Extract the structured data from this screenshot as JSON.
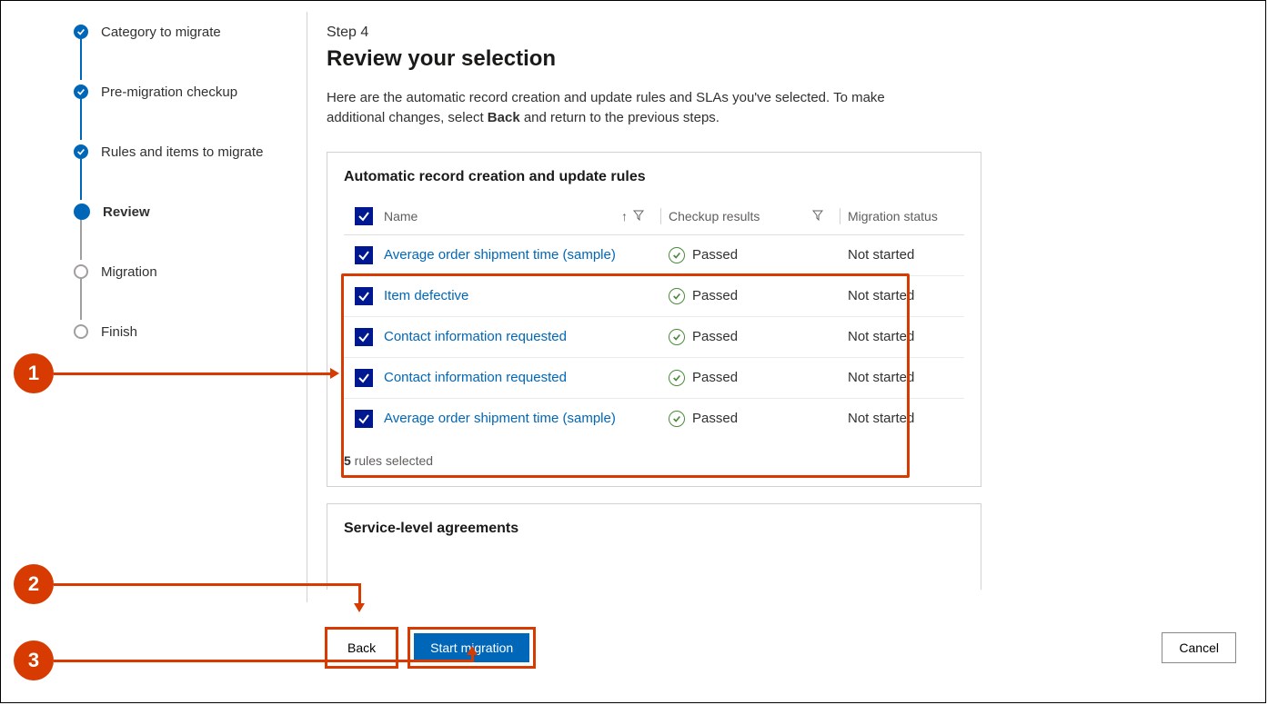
{
  "steps": [
    {
      "label": "Category to migrate",
      "state": "done"
    },
    {
      "label": "Pre-migration checkup",
      "state": "done"
    },
    {
      "label": "Rules and items to migrate",
      "state": "done"
    },
    {
      "label": "Review",
      "state": "current"
    },
    {
      "label": "Migration",
      "state": "future"
    },
    {
      "label": "Finish",
      "state": "future"
    }
  ],
  "header": {
    "step_no": "Step 4",
    "title": "Review your selection",
    "intro_pre": "Here are the automatic record creation and update rules and SLAs you've selected. To make additional changes, select ",
    "intro_bold": "Back",
    "intro_post": " and return to the previous steps."
  },
  "panel1": {
    "title": "Automatic record creation and update rules",
    "cols": {
      "name": "Name",
      "checkup": "Checkup results",
      "migration": "Migration status"
    },
    "rows": [
      {
        "name": "Average order shipment time (sample)",
        "checkup": "Passed",
        "migration": "Not started"
      },
      {
        "name": "Item defective",
        "checkup": "Passed",
        "migration": "Not started"
      },
      {
        "name": "Contact information requested",
        "checkup": "Passed",
        "migration": "Not started"
      },
      {
        "name": "Contact information requested",
        "checkup": "Passed",
        "migration": "Not started"
      },
      {
        "name": "Average order shipment time (sample)",
        "checkup": "Passed",
        "migration": "Not started"
      }
    ],
    "selected_count": "5",
    "selected_suffix": " rules selected"
  },
  "panel2": {
    "title": "Service-level agreements"
  },
  "buttons": {
    "back": "Back",
    "start": "Start migration",
    "cancel": "Cancel"
  },
  "callouts": {
    "c1": "1",
    "c2": "2",
    "c3": "3"
  }
}
